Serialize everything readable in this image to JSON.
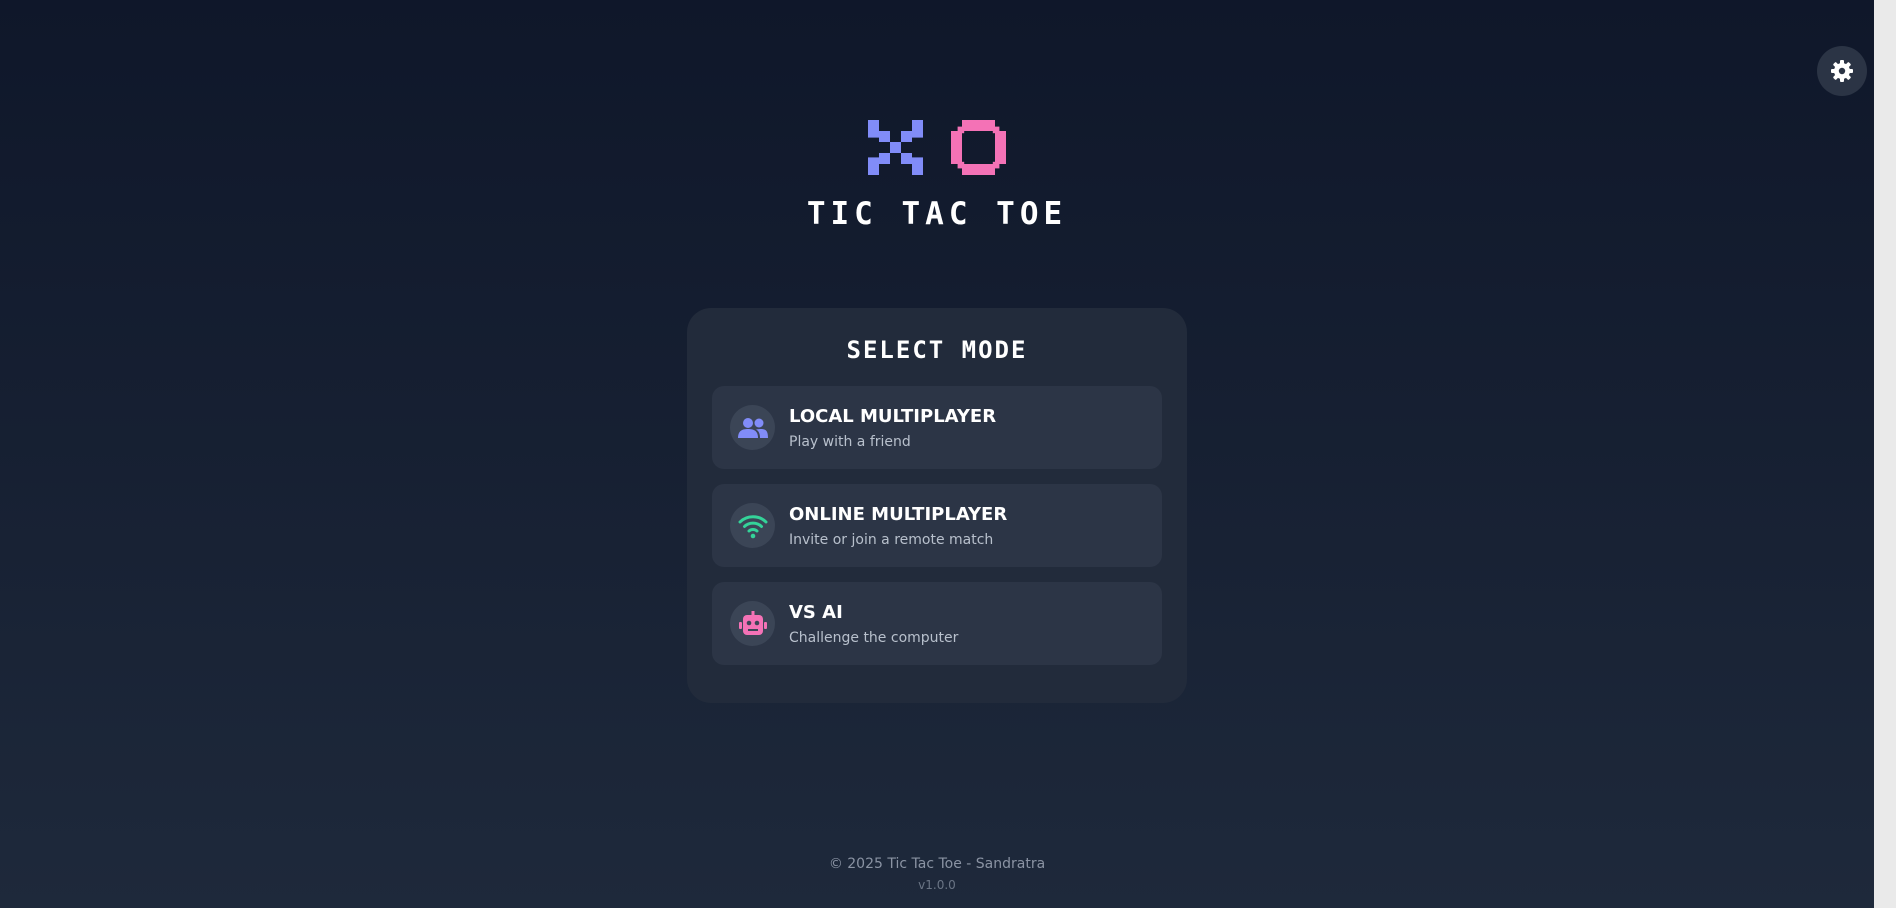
{
  "header": {
    "settings_icon": "gear-icon",
    "logo": {
      "x_symbol": "X",
      "o_symbol": "O",
      "x_color": "#818cf8",
      "o_color": "#f472b6"
    },
    "title": "TIC TAC TOE"
  },
  "mode_card": {
    "title": "SELECT MODE",
    "options": [
      {
        "label": "LOCAL MULTIPLAYER",
        "description": "Play with a friend",
        "icon": "users-icon",
        "icon_color": "#818cf8"
      },
      {
        "label": "ONLINE MULTIPLAYER",
        "description": "Invite or join a remote match",
        "icon": "wifi-icon",
        "icon_color": "#34d399"
      },
      {
        "label": "VS AI",
        "description": "Challenge the computer",
        "icon": "robot-icon",
        "icon_color": "#f472b6"
      }
    ]
  },
  "footer": {
    "copyright": "© 2025 Tic Tac Toe - Sandratra",
    "version": "v1.0.0"
  },
  "colors": {
    "background_top": "#0f172a",
    "background_bottom": "#1e293b",
    "card": "#222b3b",
    "option": "#2c3546"
  }
}
